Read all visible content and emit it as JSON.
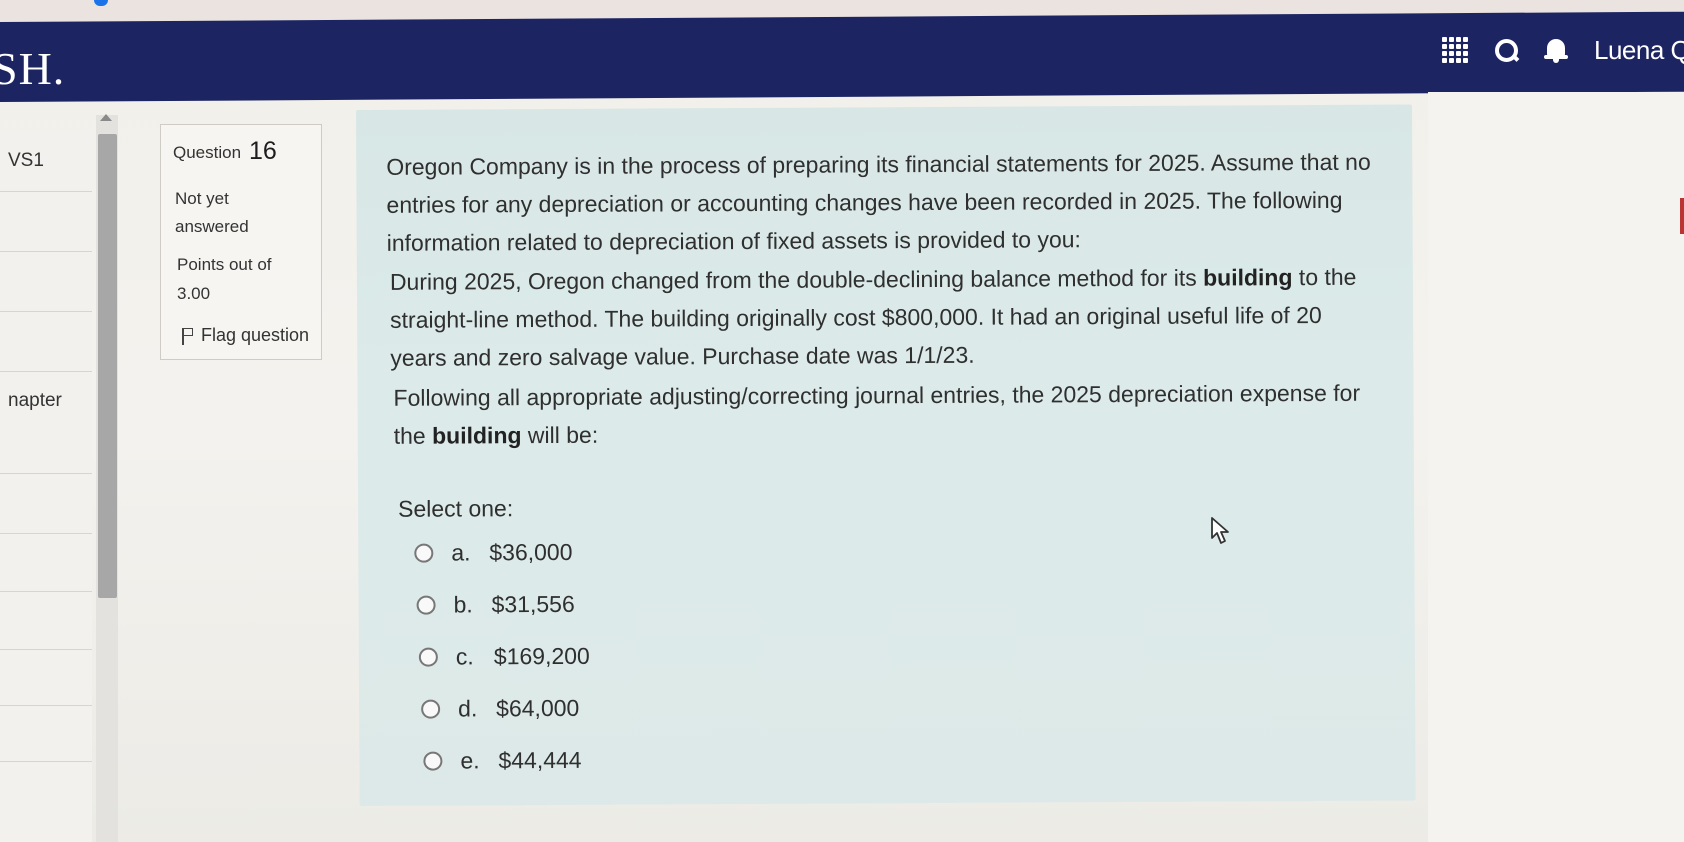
{
  "header": {
    "brand": "SH.",
    "user_name": "Luena Q"
  },
  "nav": {
    "items": [
      "VS1",
      "",
      "",
      "",
      "napter",
      "",
      "",
      "",
      "",
      "",
      ""
    ]
  },
  "question_info": {
    "label": "Question",
    "number": "16",
    "status": "Not yet answered",
    "points_label": "Points out of",
    "points_value": "3.00",
    "flag_label": "Flag question"
  },
  "question": {
    "intro": "Oregon Company is in the process of preparing its financial statements for 2025.  Assume that no entries for any depreciation or accounting changes have been recorded in 2025.  The following information related to depreciation of fixed assets is provided to you:",
    "details_part1": "During 2025, Oregon changed from the double-declining balance method for its",
    "details_bold": "building",
    "details_part2": "to the straight-line method.  The building originally cost $800,000.  It had an original useful life of 20 years and zero salvage value.  Purchase date was 1/1/23.",
    "prompt_part1": "Following all appropriate adjusting/correcting journal entries, the 2025 depreciation expense for the",
    "prompt_bold": "building",
    "prompt_part2": "will be:",
    "select_label": "Select one:",
    "options": [
      {
        "letter": "a.",
        "value": "$36,000"
      },
      {
        "letter": "b.",
        "value": "$31,556"
      },
      {
        "letter": "c.",
        "value": "$169,200"
      },
      {
        "letter": "d.",
        "value": "$64,000"
      },
      {
        "letter": "e.",
        "value": "$44,444"
      }
    ]
  },
  "icons": {
    "apps": "grid-icon",
    "search": "search-icon",
    "notifications": "bell-icon",
    "flag": "flag-icon",
    "cursor": "mouse-pointer-icon"
  },
  "colors": {
    "header_bg": "#1c2462",
    "question_bg": "#dbe9e8",
    "info_bg": "#f6f5f2"
  }
}
